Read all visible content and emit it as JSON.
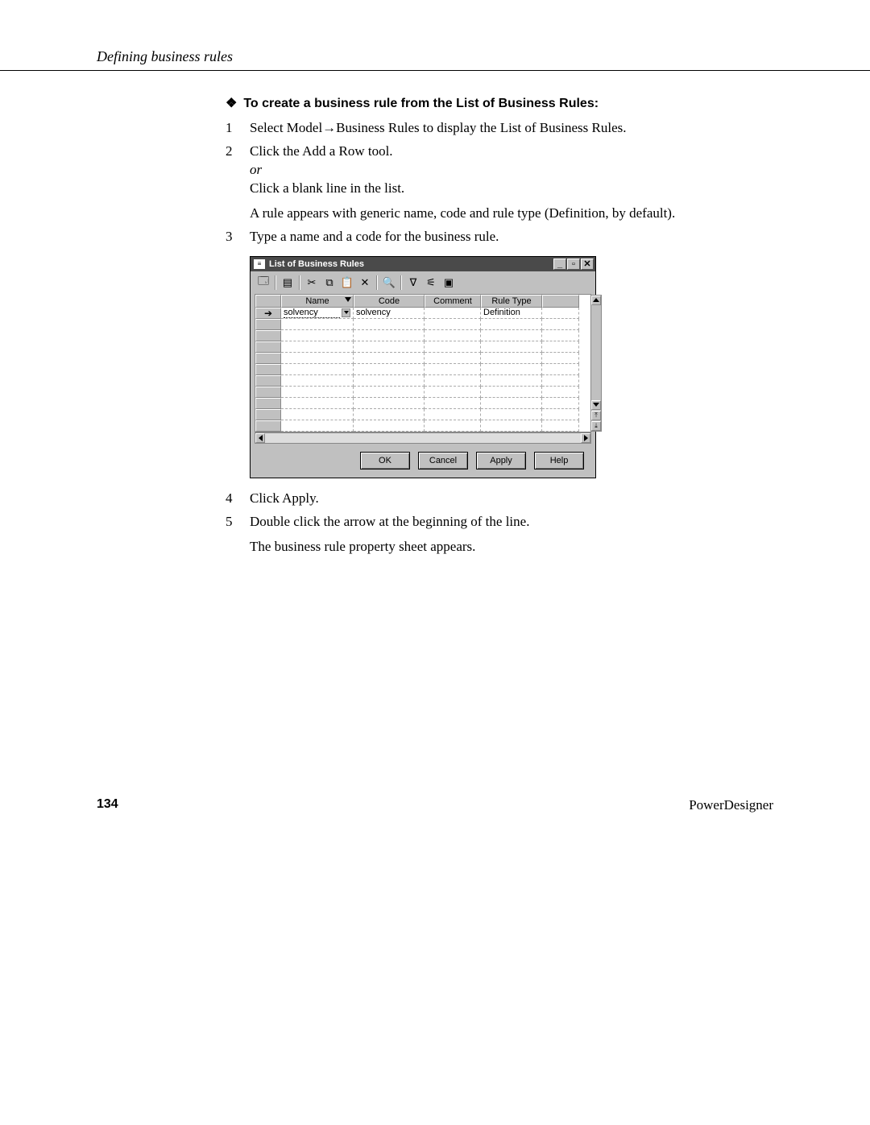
{
  "header": {
    "running_head": "Defining business rules"
  },
  "section": {
    "bullet": "❖",
    "title": "To create a business rule from the List of Business Rules:"
  },
  "steps": {
    "1": {
      "num": "1",
      "text": "Select Model→Business Rules to display the List of Business Rules."
    },
    "2": {
      "num": "2",
      "line1": "Click the Add a Row tool.",
      "or": "or",
      "line2": "Click a blank line in the list.",
      "result": "A rule appears with generic name, code and rule type (Definition, by default)."
    },
    "3": {
      "num": "3",
      "text": "Type a name and a code for the business rule."
    },
    "4": {
      "num": "4",
      "text": "Click Apply."
    },
    "5": {
      "num": "5",
      "line1": "Double click the arrow at the beginning of the line.",
      "result": "The business rule property sheet appears."
    }
  },
  "dialog": {
    "title": "List of Business Rules",
    "columns": {
      "name": "Name",
      "code": "Code",
      "comment": "Comment",
      "ruletype": "Rule Type"
    },
    "row": {
      "name": "solvency",
      "code": "solvency",
      "comment": "",
      "ruletype": "Definition"
    },
    "buttons": {
      "ok": "OK",
      "cancel": "Cancel",
      "apply": "Apply",
      "help": "Help"
    }
  },
  "footer": {
    "page": "134",
    "product": "PowerDesigner"
  }
}
